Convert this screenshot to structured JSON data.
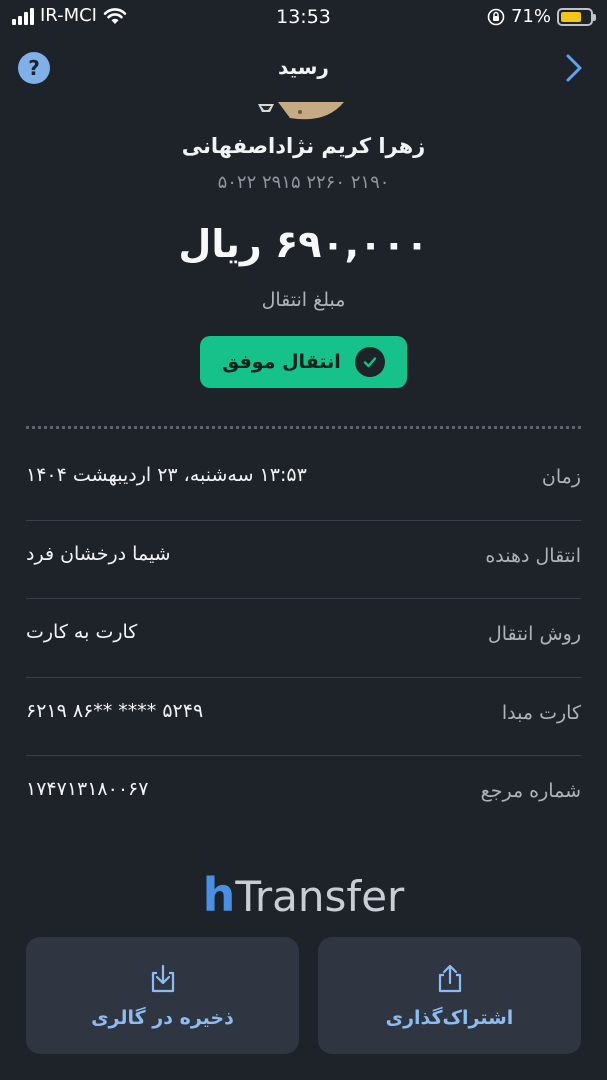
{
  "status_bar": {
    "carrier": "IR-MCI",
    "time": "13:53",
    "battery_text": "71%",
    "battery_level": 0.71,
    "battery_color": "#f5c518"
  },
  "header": {
    "title": "رسید",
    "help_icon": "question-circle-icon",
    "help_glyph": "?",
    "back_icon": "chevron-right-icon"
  },
  "payee": {
    "name": "زهرا کریم نژاداصفهانی",
    "card_number": "۵۰۲۲ ۲۹۱۵ ۲۲۶۰ ۲۱۹۰"
  },
  "amount": {
    "value": "۶۹۰,۰۰۰ ریال",
    "label": "مبلغ انتقال"
  },
  "status": {
    "label": "انتقال موفق",
    "color": "#16c18a"
  },
  "details": [
    {
      "label": "زمان",
      "value": "۱۳:۵۳ سه‌شنبه، ۲۳ اردیبهشت ۱۴۰۴"
    },
    {
      "label": "انتقال دهنده",
      "value": "شیما درخشان فرد"
    },
    {
      "label": "روش انتقال",
      "value": "کارت به کارت"
    },
    {
      "label": "کارت مبدا",
      "value": "۶۲۱۹ ۸۶** **** ۵۲۴۹"
    },
    {
      "label": "شماره مرجع",
      "value": "۱۷۴۷۱۳۱۸۰۰۶۷"
    }
  ],
  "brand": {
    "h": "h",
    "t": "Transfer"
  },
  "actions": {
    "save_label": "ذخیره در گالری",
    "save_icon": "download-icon",
    "share_label": "اشتراک‌گذاری",
    "share_icon": "share-icon"
  }
}
